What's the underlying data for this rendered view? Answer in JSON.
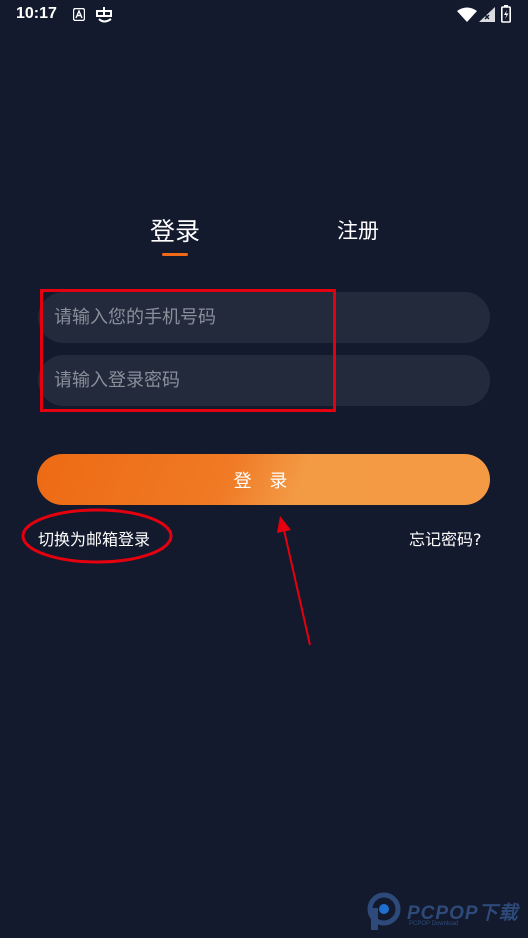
{
  "status_bar": {
    "time": "10:17",
    "icons": [
      "a-icon",
      "carrier-glyph-icon",
      "wifi-icon",
      "signal-icon",
      "battery-charging-icon"
    ]
  },
  "tabs": [
    {
      "label": "登录",
      "active": true
    },
    {
      "label": "注册",
      "active": false
    }
  ],
  "form": {
    "phone_placeholder": "请输入您的手机号码",
    "phone_value": "",
    "password_placeholder": "请输入登录密码",
    "password_value": ""
  },
  "login_button_label": "登 录",
  "links": {
    "switch_email": "切换为邮箱登录",
    "forgot_password": "忘记密码?"
  },
  "watermark": {
    "text": "PCPOP下载",
    "sub": "PCPOP Download"
  },
  "colors": {
    "background": "#131a2d",
    "accent": "#f06a17",
    "input_bg": "#222a3c",
    "annotation": "#e5000f"
  }
}
